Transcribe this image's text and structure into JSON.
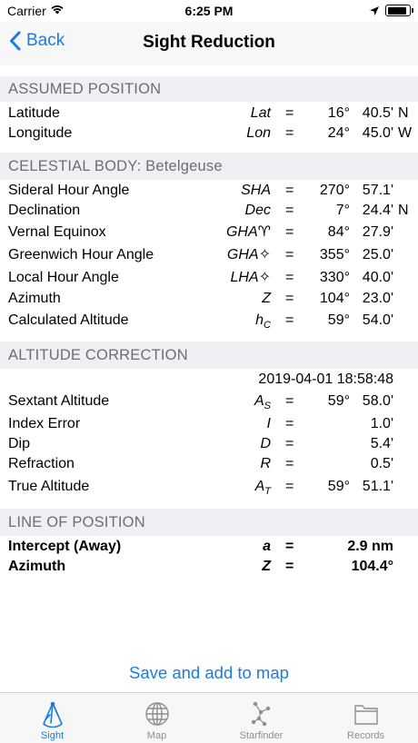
{
  "status_bar": {
    "carrier": "Carrier",
    "time": "6:25 PM"
  },
  "nav": {
    "back_label": "Back",
    "title": "Sight Reduction"
  },
  "assumed_position": {
    "header": "ASSUMED POSITION",
    "rows": [
      {
        "label": "Latitude",
        "symbol": "Lat",
        "eq": "=",
        "deg": "16°",
        "min": "40.5'",
        "hemi": "N"
      },
      {
        "label": "Longitude",
        "symbol": "Lon",
        "eq": "=",
        "deg": "24°",
        "min": "45.0'",
        "hemi": "W"
      }
    ]
  },
  "celestial_body": {
    "header": "CELESTIAL BODY: Betelgeuse",
    "rows": [
      {
        "label": "Sideral Hour Angle",
        "symbol": "SHA",
        "eq": "=",
        "deg": "270°",
        "min": "57.1'"
      },
      {
        "label": "Declination",
        "symbol": "Dec",
        "eq": "=",
        "deg": "7°",
        "min": "24.4'",
        "hemi": "N"
      },
      {
        "label": "Vernal Equinox",
        "symbol": "GHA♈",
        "eq": "=",
        "deg": "84°",
        "min": "27.9'"
      },
      {
        "label": "Greenwich Hour Angle",
        "symbol": "GHA✧",
        "eq": "=",
        "deg": "355°",
        "min": "25.0'"
      },
      {
        "label": "Local Hour Angle",
        "symbol": "LHA✧",
        "eq": "=",
        "deg": "330°",
        "min": "40.0'"
      },
      {
        "label": "Azimuth",
        "symbol": "Z",
        "eq": "=",
        "deg": "104°",
        "min": "23.0'"
      },
      {
        "label": "Calculated Altitude",
        "symbol": "h",
        "sub": "C",
        "eq": "=",
        "deg": "59°",
        "min": "54.0'"
      }
    ]
  },
  "altitude_correction": {
    "header": "ALTITUDE CORRECTION",
    "timestamp": "2019-04-01 18:58:48",
    "rows": [
      {
        "label": "Sextant Altitude",
        "symbol": "A",
        "sub": "S",
        "eq": "=",
        "deg": "59°",
        "min": "58.0'"
      },
      {
        "label": "Index Error",
        "symbol": "I",
        "eq": "=",
        "value": "1.0'"
      },
      {
        "label": "Dip",
        "symbol": "D",
        "eq": "=",
        "value": "5.4'"
      },
      {
        "label": "Refraction",
        "symbol": "R",
        "eq": "=",
        "value": "0.5'"
      },
      {
        "label": "True Altitude",
        "symbol": "A",
        "sub": "T",
        "eq": "=",
        "deg": "59°",
        "min": "51.1'"
      }
    ]
  },
  "line_of_position": {
    "header": "LINE OF POSITION",
    "rows": [
      {
        "label": "Intercept (Away)",
        "symbol": "a",
        "eq": "=",
        "value": "2.9 nm"
      },
      {
        "label": "Azimuth",
        "symbol": "Z",
        "eq": "=",
        "value": "104.4°"
      }
    ]
  },
  "save_button": "Save and add to map",
  "tabs": [
    {
      "label": "Sight",
      "icon": "sextant-icon",
      "active": true
    },
    {
      "label": "Map",
      "icon": "globe-icon",
      "active": false
    },
    {
      "label": "Starfinder",
      "icon": "constellation-icon",
      "active": false
    },
    {
      "label": "Records",
      "icon": "folder-icon",
      "active": false
    }
  ],
  "colors": {
    "accent": "#1a7ce4",
    "section_bg": "#efeff4",
    "section_text": "#6d6d72"
  }
}
